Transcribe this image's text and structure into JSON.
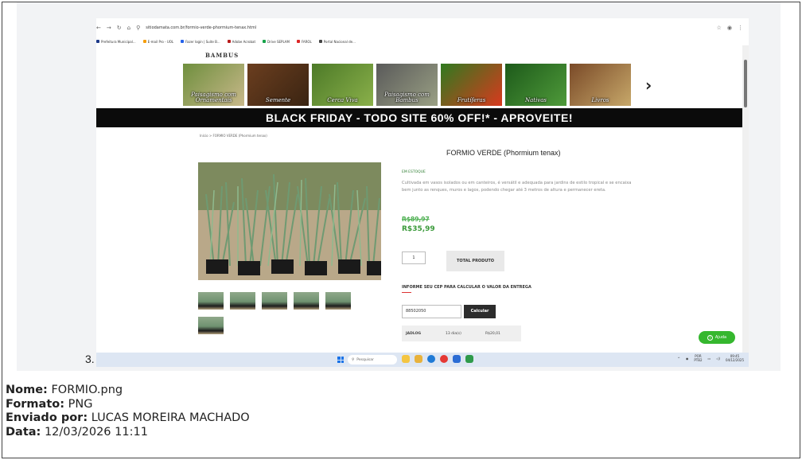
{
  "browser": {
    "url": "sitiodamata.com.br/formio-verde-phormium-tenax.html",
    "bookmarks": [
      {
        "label": "Prefeitura Municipal...",
        "color": "#1e3a8a"
      },
      {
        "label": "E-mail Pro - UOL",
        "color": "#f59e0b"
      },
      {
        "label": "Fazer login | Suite B...",
        "color": "#2563eb"
      },
      {
        "label": "Adobe Acrobat",
        "color": "#b91c1c"
      },
      {
        "label": "Drive SEPLAM",
        "color": "#16a34a"
      },
      {
        "label": "FAROL",
        "color": "#dc2626"
      },
      {
        "label": "Portal Nacional de...",
        "color": "#444444"
      }
    ]
  },
  "site": {
    "brand": "BAMBUS",
    "categories": [
      {
        "label": "Paisagismo com Ornamentais",
        "colors": [
          "#6f8f3e",
          "#c8b88a"
        ]
      },
      {
        "label": "Semente",
        "colors": [
          "#6b3e1f",
          "#3a2412"
        ]
      },
      {
        "label": "Cerca Viva",
        "colors": [
          "#4d7a28",
          "#8ab04a"
        ]
      },
      {
        "label": "Paisagismo com Bambus",
        "colors": [
          "#5a5a5a",
          "#9aa084"
        ]
      },
      {
        "label": "Frutíferas",
        "colors": [
          "#2f7a1f",
          "#d9391e"
        ]
      },
      {
        "label": "Nativas",
        "colors": [
          "#1d5a1a",
          "#4f9a3a"
        ]
      },
      {
        "label": "Livros",
        "colors": [
          "#7a4a28",
          "#c7a86a"
        ]
      }
    ],
    "banner": "BLACK FRIDAY - TODO SITE 60% OFF!* - APROVEITE!"
  },
  "product": {
    "breadcrumb": "Início  >  FORMIO VERDE (Phormium tenax)",
    "title": "FORMIO VERDE (Phormium tenax)",
    "stock": "EM ESTOQUE",
    "description": "Cultivada em vasos isolados ou em canteiros, é versátil e adequada para jardins de estilo tropical e se encaixa bem junto as renques, muros e lagos, podendo chegar até 3 metros de altura e permanecer ereta.",
    "old_price": "R$89,97",
    "new_price": "R$35,99",
    "quantity": "1",
    "total_label": "TOTAL PRODUTO",
    "cep_label": "INFORME SEU CEP PARA CALCULAR O VALOR DA ENTREGA",
    "cep_value": "88502050",
    "calc_label": "Calcular",
    "shipping": {
      "carrier": "JADLOG",
      "days": "13 dia(s)",
      "price": "R$20,01"
    },
    "help_label": "Ajuda"
  },
  "taskbar": {
    "search_placeholder": "Pesquisar",
    "lang": "POR",
    "lang2": "PTB2",
    "time": "09:45",
    "date": "04/12/2025"
  },
  "caption_number": "3.",
  "meta": {
    "name_label": "Nome:",
    "name_value": " FORMIO.png",
    "format_label": "Formato:",
    "format_value": " PNG",
    "sent_label": "Enviado por:",
    "sent_value": " LUCAS MOREIRA MACHADO",
    "date_label": "Data:",
    "date_value": " 12/03/2026 11:11"
  }
}
